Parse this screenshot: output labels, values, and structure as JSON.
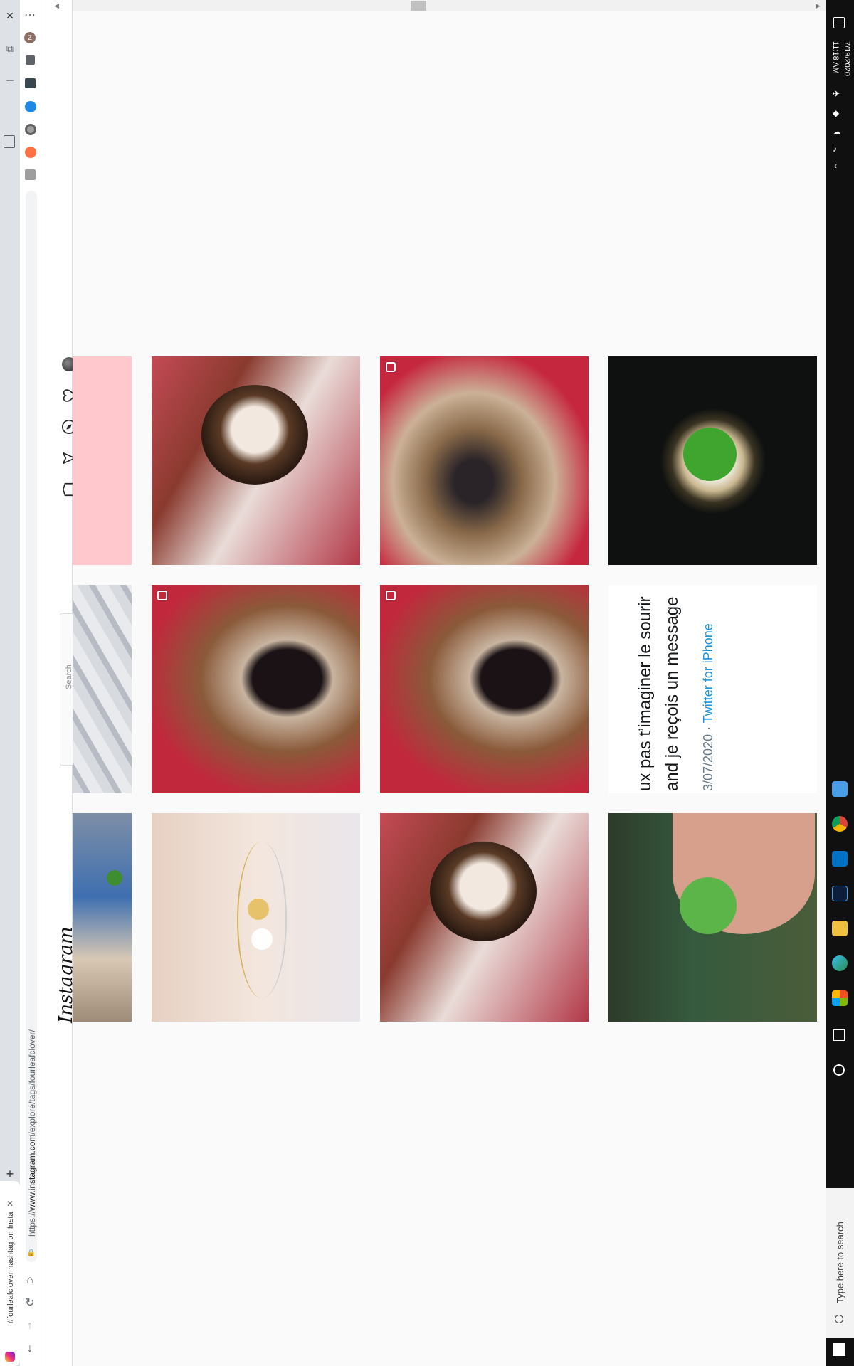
{
  "browser": {
    "tab_title": "#fourleafclover hashtag on Insta",
    "tab_close": "✕",
    "new_tab": "+",
    "url": "https://www.instagram.com/explore/tags/fourleafclover/",
    "url_prefix": "https://",
    "url_host": "www.instagram.com",
    "url_path": "/explore/tags/fourleafclover/",
    "window_close": "✕",
    "window_minimize": "—",
    "menu_dots": "⋯",
    "profile_initial": "Z"
  },
  "instagram": {
    "logo": "Instagram",
    "search_placeholder": "Search"
  },
  "grid": {
    "tweet_line1": "ux pas t’imaginer le sourir",
    "tweet_line2": "and je reçois un message",
    "tweet_date": "3/07/2020 · ",
    "tweet_source": "Twitter for iPhone"
  },
  "taskbar": {
    "time": "11:18 AM",
    "date": "7/19/2020",
    "search_placeholder": "Type here to search"
  },
  "colors": {
    "tab_strip": "#dee1e6",
    "ig_border": "#dbdbdb",
    "taskbar": "#101010",
    "twitter_blue": "#1b95e0",
    "pink_tile": "#fec8cc"
  }
}
